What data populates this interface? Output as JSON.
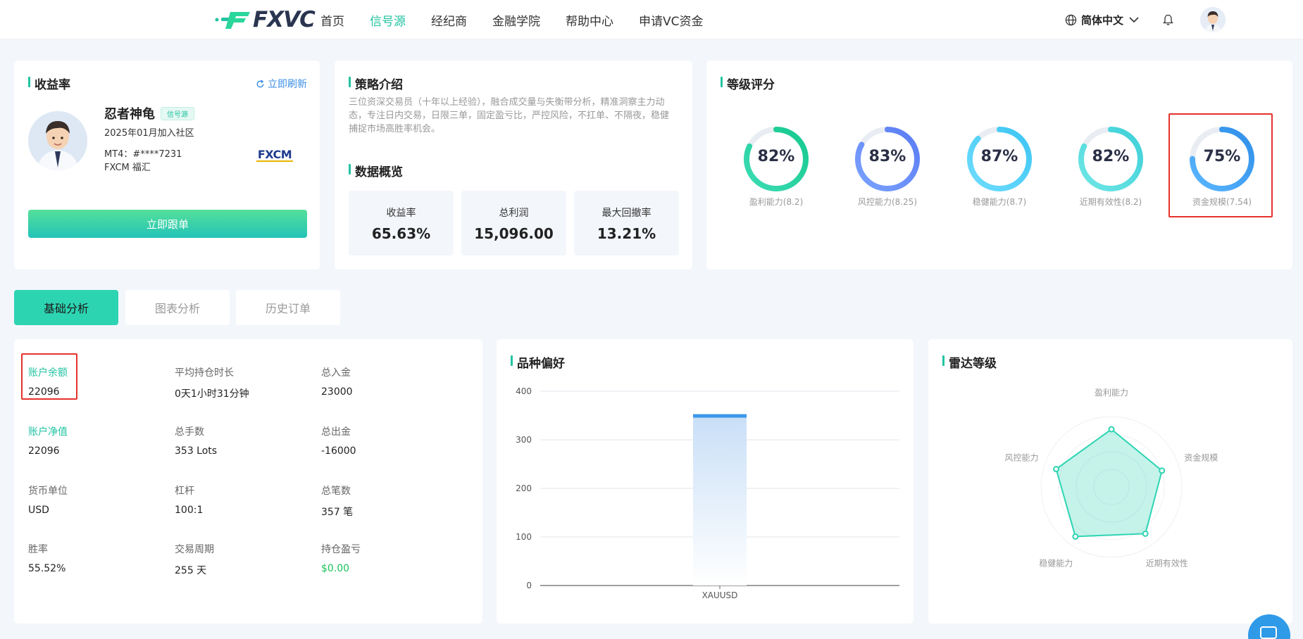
{
  "header": {
    "logo_text": "FXVC",
    "nav": [
      {
        "label": "首页",
        "active": false
      },
      {
        "label": "信号源",
        "active": true
      },
      {
        "label": "经纪商",
        "active": false
      },
      {
        "label": "金融学院",
        "active": false
      },
      {
        "label": "帮助中心",
        "active": false
      },
      {
        "label": "申请VC资金",
        "active": false
      }
    ],
    "language": "简体中文"
  },
  "profile_card": {
    "title": "收益率",
    "refresh_label": "立即刷新",
    "name": "忍者神龟",
    "tag": "信号源",
    "joined": "2025年01月加入社区",
    "mt4": "MT4：#****7231",
    "broker": "FXCM 福汇",
    "broker_logo": "FXCM",
    "follow_button": "立即跟单"
  },
  "strategy_card": {
    "title": "策略介绍",
    "description": "三位资深交易员（十年以上经验），融合成交量与失衡带分析，精准洞察主力动态，专注日内交易，日限三单，固定盈亏比，严控风险，不扛单、不隔夜，稳健捕捉市场高胜率机会。",
    "overview_title": "数据概览",
    "stats": [
      {
        "label": "收益率",
        "value": "65.63%"
      },
      {
        "label": "总利润",
        "value": "15,096.00"
      },
      {
        "label": "最大回撤率",
        "value": "13.21%"
      }
    ]
  },
  "grade_card": {
    "title": "等级评分",
    "rings": [
      {
        "pct": "82%",
        "fraction": 0.82,
        "label": "盈利能力(8.2)",
        "color_a": "#16c98e",
        "color_b": "#3ddcb4"
      },
      {
        "pct": "83%",
        "fraction": 0.83,
        "label": "风控能力(8.25)",
        "color_a": "#5a7cf2",
        "color_b": "#7aa2ff"
      },
      {
        "pct": "87%",
        "fraction": 0.87,
        "label": "稳健能力(8.7)",
        "color_a": "#3cc6f2",
        "color_b": "#6fdcff"
      },
      {
        "pct": "82%",
        "fraction": 0.82,
        "label": "近期有效性(8.2)",
        "color_a": "#3ed0d8",
        "color_b": "#6fe6e6"
      },
      {
        "pct": "75%",
        "fraction": 0.75,
        "label": "资金规模(7.54)",
        "color_a": "#2f8ee8",
        "color_b": "#5ab6ff"
      }
    ]
  },
  "tabs": [
    {
      "label": "基础分析",
      "active": true
    },
    {
      "label": "图表分析",
      "active": false
    },
    {
      "label": "历史订单",
      "active": false
    }
  ],
  "basic_stats": [
    {
      "label": "账户余额",
      "value": "22096",
      "green_label": true
    },
    {
      "label": "平均持仓时长",
      "value": "0天1小时31分钟"
    },
    {
      "label": "总入金",
      "value": "23000"
    },
    {
      "label": "账户净值",
      "value": "22096",
      "green_label": true
    },
    {
      "label": "总手数",
      "value": "353 Lots"
    },
    {
      "label": "总出金",
      "value": "-16000"
    },
    {
      "label": "货币单位",
      "value": "USD"
    },
    {
      "label": "杠杆",
      "value": "100:1"
    },
    {
      "label": "总笔数",
      "value": "357 笔"
    },
    {
      "label": "胜率",
      "value": "55.52%"
    },
    {
      "label": "交易周期",
      "value": "255 天"
    },
    {
      "label": "持仓盈亏",
      "value": "$0.00",
      "green_value": true
    }
  ],
  "preference_card": {
    "title": "品种偏好"
  },
  "radar_card": {
    "title": "雷达等级"
  },
  "chart_data": [
    {
      "type": "bar",
      "title": "品种偏好",
      "categories": [
        "XAUUSD"
      ],
      "values": [
        350
      ],
      "yticks": [
        0,
        100,
        200,
        300,
        400
      ],
      "ylim": [
        0,
        400
      ],
      "grid": true,
      "color": "#3b97ea"
    },
    {
      "type": "radar",
      "title": "雷达等级",
      "axes": [
        "盈利能力",
        "资金规模",
        "近期有效性",
        "稳健能力",
        "风控能力"
      ],
      "max": 10,
      "values": [
        8.2,
        7.54,
        8.2,
        8.7,
        8.25
      ],
      "color": "#2dd4b2"
    }
  ]
}
